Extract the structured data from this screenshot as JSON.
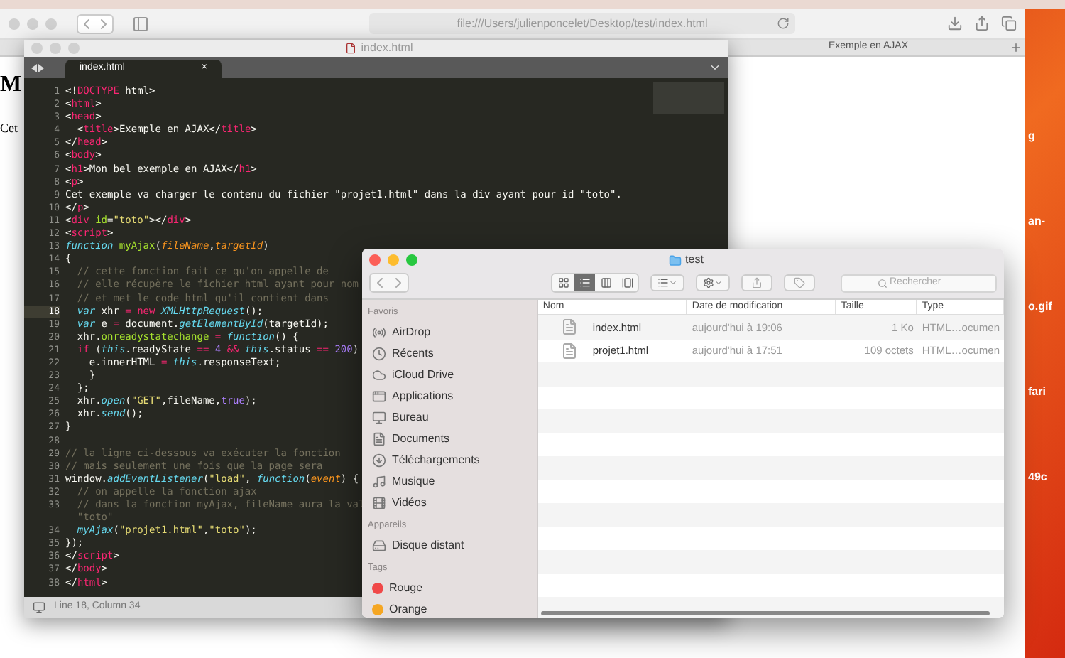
{
  "safari": {
    "url": "file:///Users/julienponcelet/Desktop/test/index.html",
    "tabs": [
      {
        "label": "Exemple en AJAX",
        "selected": false
      }
    ],
    "page": {
      "heading": "M",
      "paragraph": "Cet"
    }
  },
  "desktop": {
    "labels": [
      "g",
      "an-",
      "o.gif",
      "fari",
      "49c"
    ]
  },
  "editor": {
    "title": "index.html",
    "tab": {
      "label": "index.html",
      "close": "×"
    },
    "status": "Line 18, Column 34",
    "lines": [
      {
        "n": "1",
        "current": false,
        "tokens": [
          {
            "kind": "plain",
            "text": "<!"
          },
          {
            "kind": "tag",
            "text": "DOCTYPE"
          },
          {
            "kind": "plain",
            "text": " html>"
          }
        ]
      },
      {
        "n": "2",
        "current": false,
        "tokens": [
          {
            "kind": "plain",
            "text": "<"
          },
          {
            "kind": "tag",
            "text": "html"
          },
          {
            "kind": "plain",
            "text": ">"
          }
        ]
      },
      {
        "n": "3",
        "current": false,
        "tokens": [
          {
            "kind": "plain",
            "text": "<"
          },
          {
            "kind": "tag",
            "text": "head"
          },
          {
            "kind": "plain",
            "text": ">"
          }
        ]
      },
      {
        "n": "4",
        "current": false,
        "tokens": [
          {
            "kind": "plain",
            "text": "  <"
          },
          {
            "kind": "tag",
            "text": "title"
          },
          {
            "kind": "plain",
            "text": ">Exemple en AJAX</"
          },
          {
            "kind": "tag",
            "text": "title"
          },
          {
            "kind": "plain",
            "text": ">"
          }
        ]
      },
      {
        "n": "5",
        "current": false,
        "tokens": [
          {
            "kind": "plain",
            "text": "</"
          },
          {
            "kind": "tag",
            "text": "head"
          },
          {
            "kind": "plain",
            "text": ">"
          }
        ]
      },
      {
        "n": "6",
        "current": false,
        "tokens": [
          {
            "kind": "plain",
            "text": "<"
          },
          {
            "kind": "tag",
            "text": "body"
          },
          {
            "kind": "plain",
            "text": ">"
          }
        ]
      },
      {
        "n": "7",
        "current": false,
        "tokens": [
          {
            "kind": "plain",
            "text": "<"
          },
          {
            "kind": "tag",
            "text": "h1"
          },
          {
            "kind": "plain",
            "text": ">Mon bel exemple en AJAX</"
          },
          {
            "kind": "tag",
            "text": "h1"
          },
          {
            "kind": "plain",
            "text": ">"
          }
        ]
      },
      {
        "n": "8",
        "current": false,
        "tokens": [
          {
            "kind": "plain",
            "text": "<"
          },
          {
            "kind": "tag",
            "text": "p"
          },
          {
            "kind": "plain",
            "text": ">"
          }
        ]
      },
      {
        "n": "9",
        "current": false,
        "tokens": [
          {
            "kind": "plain",
            "text": "Cet exemple va charger le contenu du fichier \"projet1.html\" dans la div ayant pour id \"toto\"."
          }
        ]
      },
      {
        "n": "10",
        "current": false,
        "tokens": [
          {
            "kind": "plain",
            "text": "</"
          },
          {
            "kind": "tag",
            "text": "p"
          },
          {
            "kind": "plain",
            "text": ">"
          }
        ]
      },
      {
        "n": "11",
        "current": false,
        "tokens": [
          {
            "kind": "plain",
            "text": "<"
          },
          {
            "kind": "tag",
            "text": "div"
          },
          {
            "kind": "func",
            "text": " id"
          },
          {
            "kind": "plain",
            "text": "="
          },
          {
            "kind": "string",
            "text": "\"toto\""
          },
          {
            "kind": "plain",
            "text": "></"
          },
          {
            "kind": "tag",
            "text": "div"
          },
          {
            "kind": "plain",
            "text": ">"
          }
        ]
      },
      {
        "n": "12",
        "current": false,
        "tokens": [
          {
            "kind": "plain",
            "text": "<"
          },
          {
            "kind": "tag",
            "text": "script"
          },
          {
            "kind": "plain",
            "text": ">"
          }
        ]
      },
      {
        "n": "13",
        "current": false,
        "tokens": [
          {
            "kind": "keyword",
            "text": "function"
          },
          {
            "kind": "func",
            "text": " myAjax"
          },
          {
            "kind": "plain",
            "text": "("
          },
          {
            "kind": "param",
            "text": "fileName"
          },
          {
            "kind": "plain",
            "text": ","
          },
          {
            "kind": "param",
            "text": "targetId"
          },
          {
            "kind": "plain",
            "text": ")"
          }
        ]
      },
      {
        "n": "14",
        "current": false,
        "tokens": [
          {
            "kind": "plain",
            "text": "{"
          }
        ]
      },
      {
        "n": "15",
        "current": false,
        "tokens": [
          {
            "kind": "comment",
            "text": "  // cette fonction fait ce qu'on appelle de"
          }
        ]
      },
      {
        "n": "16",
        "current": false,
        "tokens": [
          {
            "kind": "comment",
            "text": "  // elle récupère le fichier html ayant pour nom"
          }
        ]
      },
      {
        "n": "17",
        "current": false,
        "tokens": [
          {
            "kind": "comment",
            "text": "  // et met le code html qu'il contient dans"
          }
        ]
      },
      {
        "n": "18",
        "current": true,
        "tokens": [
          {
            "kind": "keyword",
            "text": "  var"
          },
          {
            "kind": "plain",
            "text": " xhr "
          },
          {
            "kind": "tag",
            "text": "="
          },
          {
            "kind": "tag",
            "text": " new"
          },
          {
            "kind": "keyword",
            "text": " XMLHttpRequest"
          },
          {
            "kind": "plain",
            "text": "();"
          }
        ]
      },
      {
        "n": "19",
        "current": false,
        "tokens": [
          {
            "kind": "keyword",
            "text": "  var"
          },
          {
            "kind": "plain",
            "text": " e "
          },
          {
            "kind": "tag",
            "text": "="
          },
          {
            "kind": "plain",
            "text": " document."
          },
          {
            "kind": "keyword",
            "text": "getElementById"
          },
          {
            "kind": "plain",
            "text": "(targetId);"
          }
        ]
      },
      {
        "n": "20",
        "current": false,
        "tokens": [
          {
            "kind": "plain",
            "text": "  xhr."
          },
          {
            "kind": "func",
            "text": "onreadystatechange"
          },
          {
            "kind": "tag",
            "text": " ="
          },
          {
            "kind": "keyword",
            "text": " function"
          },
          {
            "kind": "plain",
            "text": "() {"
          }
        ]
      },
      {
        "n": "21",
        "current": false,
        "tokens": [
          {
            "kind": "tag",
            "text": "  if"
          },
          {
            "kind": "plain",
            "text": " ("
          },
          {
            "kind": "keyword",
            "text": "this"
          },
          {
            "kind": "plain",
            "text": ".readyState "
          },
          {
            "kind": "tag",
            "text": "=="
          },
          {
            "kind": "number",
            "text": " 4"
          },
          {
            "kind": "tag",
            "text": " &&"
          },
          {
            "kind": "keyword",
            "text": " this"
          },
          {
            "kind": "plain",
            "text": ".status "
          },
          {
            "kind": "tag",
            "text": "=="
          },
          {
            "kind": "number",
            "text": " 200"
          },
          {
            "kind": "plain",
            "text": ")"
          }
        ]
      },
      {
        "n": "22",
        "current": false,
        "tokens": [
          {
            "kind": "plain",
            "text": "    e.innerHTML "
          },
          {
            "kind": "tag",
            "text": "="
          },
          {
            "kind": "keyword",
            "text": " this"
          },
          {
            "kind": "plain",
            "text": ".responseText;"
          }
        ]
      },
      {
        "n": "23",
        "current": false,
        "tokens": [
          {
            "kind": "plain",
            "text": "    }"
          }
        ]
      },
      {
        "n": "24",
        "current": false,
        "tokens": [
          {
            "kind": "plain",
            "text": "  };"
          }
        ]
      },
      {
        "n": "25",
        "current": false,
        "tokens": [
          {
            "kind": "plain",
            "text": "  xhr."
          },
          {
            "kind": "keyword",
            "text": "open"
          },
          {
            "kind": "plain",
            "text": "("
          },
          {
            "kind": "string",
            "text": "\"GET\""
          },
          {
            "kind": "plain",
            "text": ",fileName,"
          },
          {
            "kind": "number",
            "text": "true"
          },
          {
            "kind": "plain",
            "text": ");"
          }
        ]
      },
      {
        "n": "26",
        "current": false,
        "tokens": [
          {
            "kind": "plain",
            "text": "  xhr."
          },
          {
            "kind": "keyword",
            "text": "send"
          },
          {
            "kind": "plain",
            "text": "();"
          }
        ]
      },
      {
        "n": "27",
        "current": false,
        "tokens": [
          {
            "kind": "plain",
            "text": "}"
          }
        ]
      },
      {
        "n": "28",
        "current": false
      },
      {
        "n": "29",
        "current": false,
        "tokens": [
          {
            "kind": "comment",
            "text": "// la ligne ci-dessous va exécuter la fonction"
          }
        ]
      },
      {
        "n": "30",
        "current": false,
        "tokens": [
          {
            "kind": "comment",
            "text": "// mais seulement une fois que la page sera"
          }
        ]
      },
      {
        "n": "31",
        "current": false,
        "tokens": [
          {
            "kind": "plain",
            "text": "window."
          },
          {
            "kind": "keyword",
            "text": "addEventListener"
          },
          {
            "kind": "plain",
            "text": "("
          },
          {
            "kind": "string",
            "text": "\"load\""
          },
          {
            "kind": "plain",
            "text": ","
          },
          {
            "kind": "keyword",
            "text": " function"
          },
          {
            "kind": "plain",
            "text": "("
          },
          {
            "kind": "param",
            "text": "event"
          },
          {
            "kind": "plain",
            "text": ") {"
          }
        ]
      },
      {
        "n": "32",
        "current": false,
        "tokens": [
          {
            "kind": "comment",
            "text": "  // on appelle la fonction ajax"
          }
        ]
      },
      {
        "n": "33",
        "current": false,
        "tokens": [
          {
            "kind": "comment",
            "text": "  // dans la fonction myAjax, fileName aura la val"
          }
        ]
      },
      {
        "current": false,
        "tokens": [
          {
            "kind": "comment",
            "text": "  \"toto\""
          }
        ]
      },
      {
        "n": "34",
        "current": false,
        "tokens": [
          {
            "kind": "keyword",
            "text": "  myAjax"
          },
          {
            "kind": "plain",
            "text": "("
          },
          {
            "kind": "string",
            "text": "\"projet1.html\""
          },
          {
            "kind": "plain",
            "text": ","
          },
          {
            "kind": "string",
            "text": "\"toto\""
          },
          {
            "kind": "plain",
            "text": ");"
          }
        ]
      },
      {
        "n": "35",
        "current": false,
        "tokens": [
          {
            "kind": "plain",
            "text": "});"
          }
        ]
      },
      {
        "n": "36",
        "current": false,
        "tokens": [
          {
            "kind": "plain",
            "text": "</"
          },
          {
            "kind": "tag",
            "text": "script"
          },
          {
            "kind": "plain",
            "text": ">"
          }
        ]
      },
      {
        "n": "37",
        "current": false,
        "tokens": [
          {
            "kind": "plain",
            "text": "</"
          },
          {
            "kind": "tag",
            "text": "body"
          },
          {
            "kind": "plain",
            "text": ">"
          }
        ]
      },
      {
        "n": "38",
        "current": false,
        "tokens": [
          {
            "kind": "plain",
            "text": "</"
          },
          {
            "kind": "tag",
            "text": "html"
          },
          {
            "kind": "plain",
            "text": ">"
          }
        ]
      }
    ]
  },
  "finder": {
    "title": "test",
    "search": {
      "placeholder": "Rechercher"
    },
    "views": [
      {
        "kind": "icons",
        "selected": false
      },
      {
        "kind": "list",
        "selected": true
      },
      {
        "kind": "columns",
        "selected": false
      },
      {
        "kind": "gallery",
        "selected": false
      }
    ],
    "sidebar": [
      {
        "heading": "Favoris",
        "items": [
          {
            "kind": "airdrop",
            "label": "AirDrop"
          },
          {
            "kind": "recent",
            "label": "Récents"
          },
          {
            "kind": "cloud",
            "label": "iCloud Drive"
          },
          {
            "kind": "apps",
            "label": "Applications"
          },
          {
            "kind": "desktop",
            "label": "Bureau"
          },
          {
            "kind": "docs",
            "label": "Documents"
          },
          {
            "kind": "download",
            "label": "Téléchargements"
          },
          {
            "kind": "music",
            "label": "Musique"
          },
          {
            "kind": "video",
            "label": "Vidéos"
          }
        ]
      },
      {
        "heading": "Appareils",
        "items": [
          {
            "kind": "disk",
            "label": "Disque distant"
          }
        ]
      },
      {
        "heading": "Tags",
        "items": [
          {
            "kind": "tag",
            "label": "Rouge",
            "color": "#f04848"
          },
          {
            "kind": "tag",
            "label": "Orange",
            "color": "#f5a623"
          }
        ]
      }
    ],
    "columns": [
      "Nom",
      "Date de modification",
      "Taille",
      "Type"
    ],
    "rows": [
      {
        "name": "index.html",
        "date": "aujourd'hui à 19:06",
        "size": "1 Ko",
        "type": "HTML…ocumen"
      },
      {
        "name": "projet1.html",
        "date": "aujourd'hui à 17:51",
        "size": "109 octets",
        "type": "HTML…ocumen"
      }
    ]
  }
}
